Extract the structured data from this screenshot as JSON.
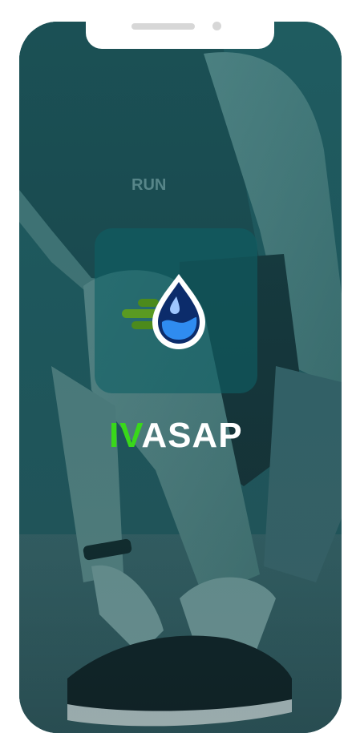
{
  "app": {
    "brand_prefix": "IV",
    "brand_suffix": "ASAP"
  },
  "icons": {
    "logo": "water-drop-speed-icon",
    "background": "runner-tying-shoe-photo"
  },
  "colors": {
    "brand_green": "#39d81a",
    "brand_white": "#ffffff",
    "drop_blue": "#1f6fe0",
    "drop_navy": "#0c2c6b",
    "speed_lines_green": "#4c8a1c",
    "overlay_teal": "#12565c"
  }
}
